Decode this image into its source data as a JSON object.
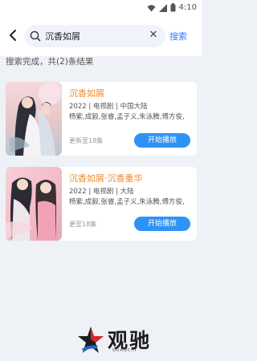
{
  "status_bar": {
    "time": "4:10"
  },
  "search": {
    "query": "沉香如屑",
    "search_button": "搜索"
  },
  "summary": "搜索完成，共(2)条结果",
  "results": [
    {
      "title": "沉香如屑",
      "meta": "2022 | 电视剧 | 中国大陆",
      "cast": "杨紫,成毅,张睿,孟子义,朱泳腾,傅方俊,",
      "update": "更新至18集",
      "play": "开始播放"
    },
    {
      "title": "沉香如屑·沉香重华",
      "meta": "2022 | 电视剧 | 大陆",
      "cast": "杨紫,成毅,张睿,孟子义,朱泳腾,傅方俊,",
      "update": "更至18集",
      "play": "开始播放"
    }
  ],
  "watermark": {
    "text": "观驰",
    "sub": "GUANCHI"
  }
}
